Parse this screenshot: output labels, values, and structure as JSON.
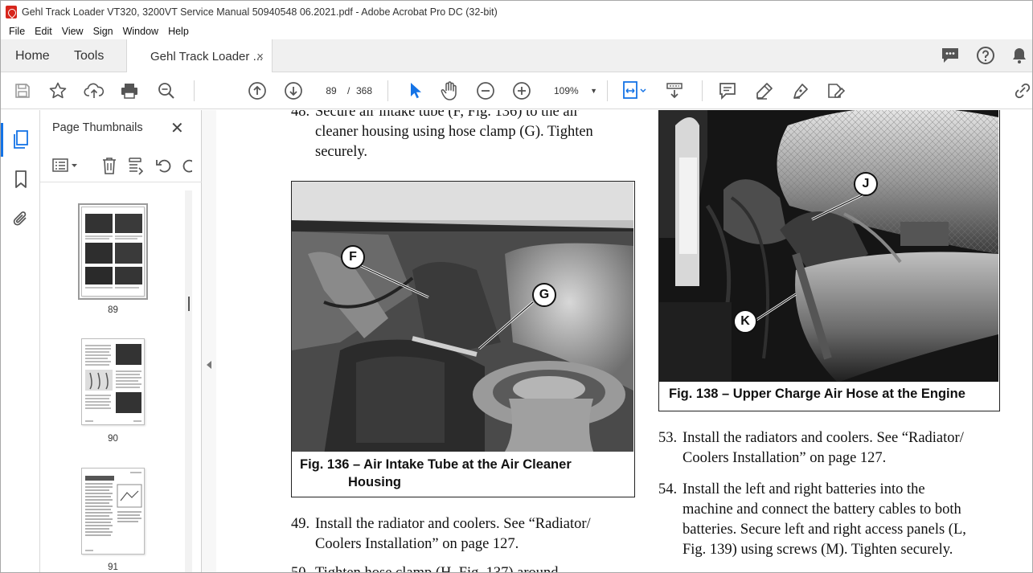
{
  "window": {
    "title": "Gehl Track Loader VT320, 3200VT Service Manual 50940548 06.2021.pdf - Adobe Acrobat Pro DC (32-bit)"
  },
  "menu": [
    "File",
    "Edit",
    "View",
    "Sign",
    "Window",
    "Help"
  ],
  "tabs": {
    "home": "Home",
    "tools": "Tools",
    "document": "Gehl Track Loader ...",
    "close": "×"
  },
  "toolbar": {
    "current_page": "89",
    "page_separator": "/",
    "total_pages": "368",
    "zoom": "109%",
    "zoom_caret": "▼"
  },
  "thumbnails": {
    "header": "Page Thumbnails",
    "close": "✕",
    "pages": [
      "89",
      "90",
      "91"
    ],
    "selected_page": "89"
  },
  "document": {
    "step48_num": "48.",
    "step48_lines": [
      "Secure air intake tube (F, Fig. 136) to the air",
      "cleaner housing using hose clamp (G). Tighten",
      "securely."
    ],
    "fig136_caption_1": "Fig. 136 – Air Intake Tube at the Air Cleaner",
    "fig136_caption_2": "Housing",
    "fig136_callouts": [
      "F",
      "G"
    ],
    "step49_num": "49.",
    "step49_lines": [
      "Install the radiator and coolers. See “Radiator/",
      "Coolers Installation” on page 127."
    ],
    "step50_num": "50.",
    "step50_line": "Tighten hose clamp (H, Fig. 137) around ...",
    "fig138_caption": "Fig. 138 – Upper Charge Air Hose at the Engine",
    "fig138_callouts": [
      "J",
      "K"
    ],
    "step53_num": "53.",
    "step53_lines": [
      "Install the radiators and coolers. See “Radiator/",
      "Coolers Installation” on page 127."
    ],
    "step54_num": "54.",
    "step54_lines": [
      "Install the left and right batteries into the",
      "machine and connect the battery cables to both",
      "batteries. Secure left and right access panels (L,",
      "Fig. 139) using screws (M). Tighten securely."
    ]
  },
  "colors": {
    "acrobat_red": "#d7261c",
    "accent_blue": "#1473e6"
  }
}
